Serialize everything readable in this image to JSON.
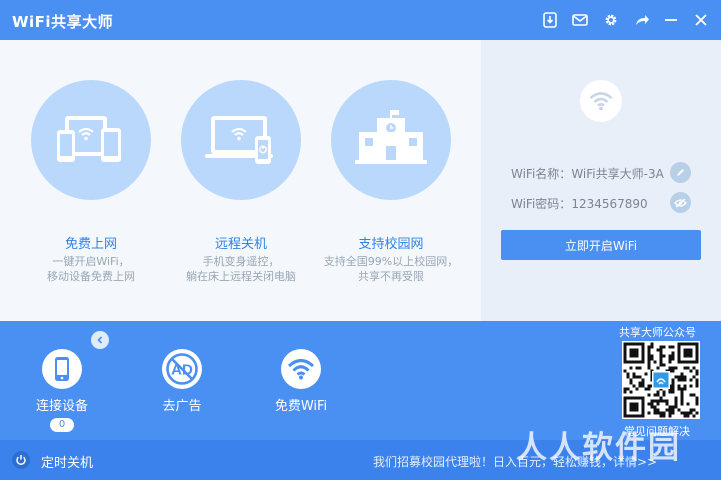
{
  "window": {
    "title": "WiFi共享大师",
    "buttons": [
      "download-icon",
      "mail-icon",
      "gear-icon",
      "share-icon",
      "minimize-icon",
      "close-icon"
    ]
  },
  "features": [
    {
      "icon": "devices-icon",
      "title": "免费上网",
      "desc1": "一键开启WiFi，",
      "desc2": "移动设备免费上网"
    },
    {
      "icon": "remote-shutdown-icon",
      "title": "远程关机",
      "desc1": "手机变身遥控，",
      "desc2": "躺在床上远程关闭电脑"
    },
    {
      "icon": "campus-icon",
      "title": "支持校园网",
      "desc1": "支持全国99%以上校园网，",
      "desc2": "共享不再受限"
    }
  ],
  "wifi_info": {
    "name_label": "WiFi名称：",
    "name_value": "WiFi共享大师-3A",
    "password_label": "WiFi密码：",
    "password_value": "1234567890",
    "start_button": "立即开启WiFi"
  },
  "tools": [
    {
      "icon": "phone-icon",
      "label": "连接设备",
      "count": "0"
    },
    {
      "icon": "ad-block-icon",
      "label": "去广告"
    },
    {
      "icon": "wifi-icon",
      "label": "免费WiFi"
    }
  ],
  "qr": {
    "title": "共享大师公众号",
    "caption": "常见问题解决"
  },
  "footer": {
    "timer_label": "定时关机",
    "notice": "我们招募校园代理啦！日入百元，轻松赚钱，详情>>"
  },
  "watermark": "人人软件园",
  "colors": {
    "primary": "#4a8ff2",
    "panel": "#f4f8fd",
    "side": "#e8eff8",
    "circle": "#b9d8fb",
    "accent_text": "#2e83e6"
  }
}
